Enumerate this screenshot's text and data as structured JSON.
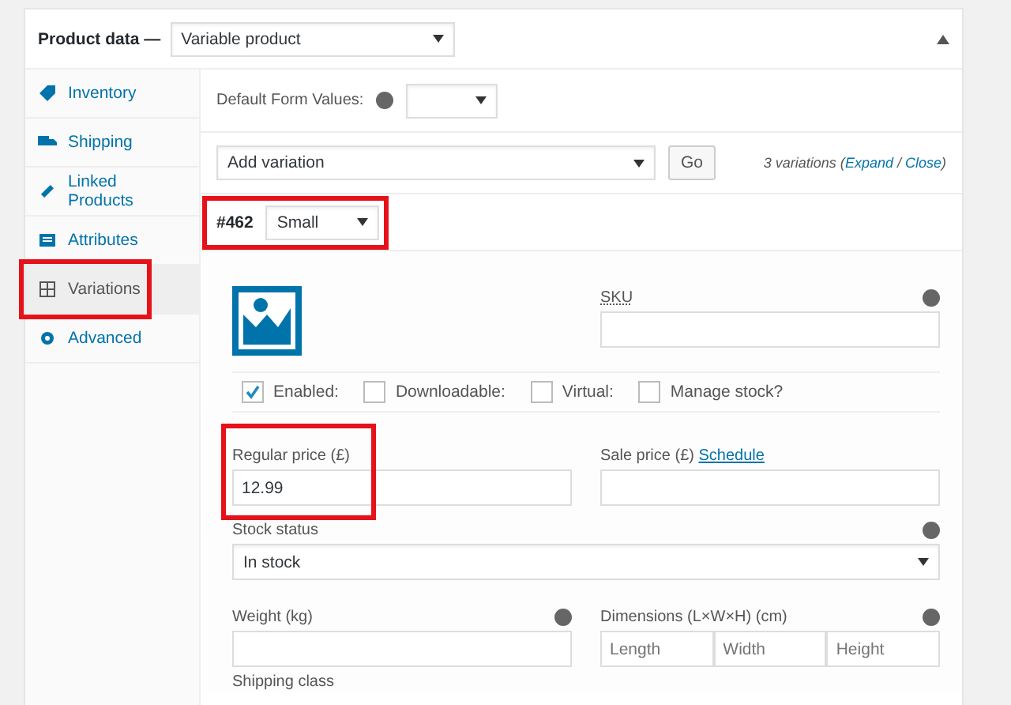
{
  "header": {
    "title": "Product data —",
    "product_type": "Variable product",
    "collapsed": false
  },
  "sidebar": {
    "items": [
      {
        "label": "Inventory",
        "selected": false,
        "highlighted": false
      },
      {
        "label": "Shipping",
        "selected": false,
        "highlighted": false
      },
      {
        "label": "Linked Products",
        "selected": false,
        "highlighted": false
      },
      {
        "label": "Attributes",
        "selected": false,
        "highlighted": false
      },
      {
        "label": "Variations",
        "selected": true,
        "highlighted": true
      },
      {
        "label": "Advanced",
        "selected": false,
        "highlighted": false
      }
    ]
  },
  "defaults": {
    "label": "Default Form Values:"
  },
  "toolbar": {
    "action": "Add variation",
    "button": "Go",
    "count": "3 variations (",
    "expand": "Expand",
    "sep": " / ",
    "close": "Close",
    "end": ")"
  },
  "variation": {
    "id": "#462",
    "option": "Small",
    "highlighted": true,
    "sku_label": "SKU",
    "checkboxes": [
      {
        "label": "Enabled:",
        "checked": true
      },
      {
        "label": "Downloadable:",
        "checked": false
      },
      {
        "label": "Virtual:",
        "checked": false
      },
      {
        "label": "Manage stock?",
        "checked": false
      }
    ],
    "regular_price": {
      "label": "Regular price (£)",
      "value": "12.99",
      "highlighted": true
    },
    "sale_price": {
      "label": "Sale price (£)",
      "link": "Schedule"
    },
    "stock_status": {
      "label": "Stock status",
      "value": "In stock"
    },
    "weight": {
      "label": "Weight (kg)"
    },
    "dimensions": {
      "label": "Dimensions (L×W×H) (cm)",
      "placeholders": [
        "Length",
        "Width",
        "Height"
      ]
    },
    "shipping_class": {
      "label": "Shipping class"
    }
  }
}
